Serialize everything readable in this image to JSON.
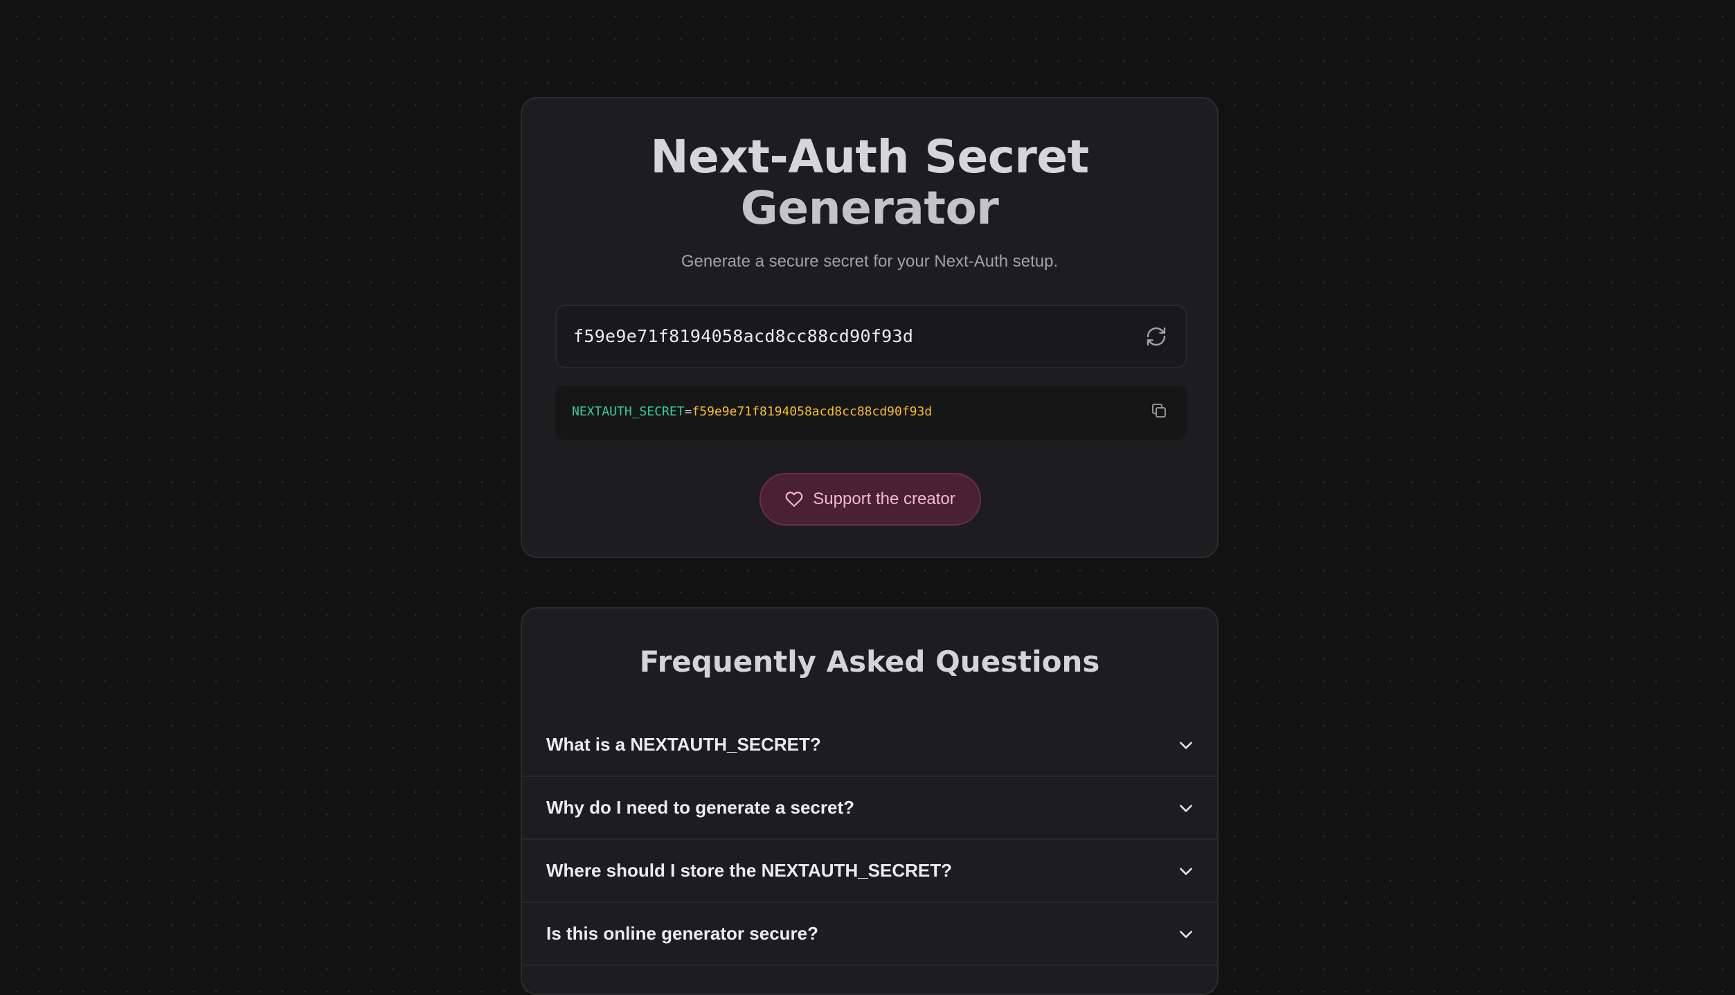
{
  "generator": {
    "title_line1": "Next-Auth Secret",
    "title_line2": "Generator",
    "subtitle": "Generate a secure secret for your Next-Auth setup.",
    "secret_value": "f59e9e71f8194058acd8cc88cd90f93d",
    "env_key": "NEXTAUTH_SECRET",
    "env_eq": "=",
    "env_value": "f59e9e71f8194058acd8cc88cd90f93d",
    "support_label": "Support the creator",
    "icons": {
      "refresh": "refresh-icon",
      "copy": "copy-icon",
      "support": "heart-icon"
    }
  },
  "faq": {
    "title": "Frequently Asked Questions",
    "items": [
      {
        "question": "What is a NEXTAUTH_SECRET?"
      },
      {
        "question": "Why do I need to generate a secret?"
      },
      {
        "question": "Where should I store the NEXTAUTH_SECRET?"
      },
      {
        "question": "Is this online generator secure?"
      }
    ]
  },
  "colors": {
    "background": "#121213",
    "card": "#1d1d1f",
    "env_key": "#34d399",
    "env_value": "#fbbf24",
    "support_bg": "#4a2033",
    "support_text": "#f5b8d0"
  }
}
